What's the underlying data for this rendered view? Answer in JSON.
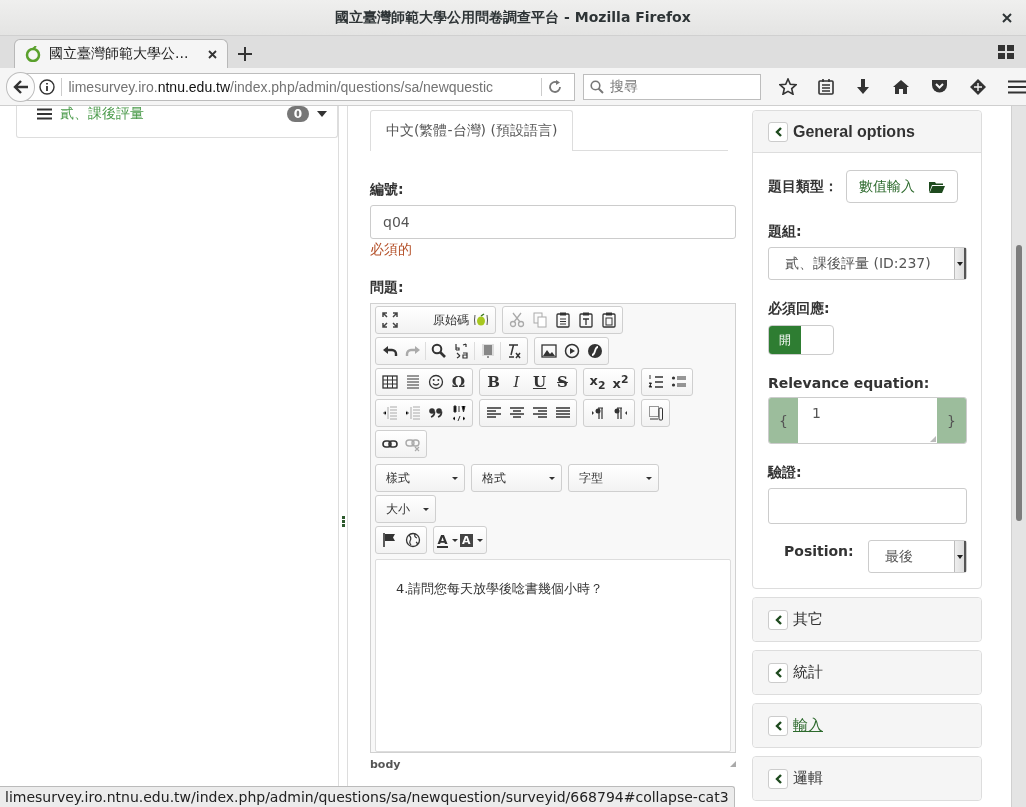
{
  "window": {
    "title": "國立臺灣師範大學公用問卷調查平台 - Mozilla Firefox"
  },
  "browser_tabs": [
    {
      "title": "國立臺灣師範大學公...",
      "selected": true
    }
  ],
  "address_bar": {
    "url_prefix": "limesurvey.iro.",
    "url_domain": "ntnu.edu.tw",
    "url_path": "/index.php/admin/questions/sa/newquestic"
  },
  "search_field": {
    "placeholder": "搜尋"
  },
  "sidebar": {
    "items": [
      {
        "label": "貳、課後評量",
        "count": "0"
      }
    ]
  },
  "language_tabs": [
    {
      "label": "中文(繁體-台灣) (預設語言)",
      "selected": true
    }
  ],
  "code_field": {
    "label": "編號:",
    "value": "q04",
    "note": "必須的"
  },
  "question_editor": {
    "label": "問題:",
    "toolbar": {
      "source": "原始碼",
      "special_character": "Ω",
      "bold": "B",
      "italic": "I",
      "underline": "U",
      "strike": "S",
      "subscript": "x$_{2}$",
      "superscript": "x$^{2}$",
      "text_color": "A",
      "background_color": "A",
      "dropdowns": [
        {
          "label": "樣式"
        },
        {
          "label": "格式"
        },
        {
          "label": "字型"
        },
        {
          "label": "大小"
        }
      ],
      "disabled": {
        "cut": true,
        "copy": true,
        "redo": true,
        "outdent": true,
        "indent": true,
        "unlink": true
      }
    },
    "content": "4.請問您每天放學後唸書幾個小時？",
    "path": "body"
  },
  "options_panels": [
    {
      "title": "General options",
      "expanded": true,
      "hovered": false
    },
    {
      "title": "其它",
      "expanded": false,
      "hovered": false
    },
    {
      "title": "統計",
      "expanded": false,
      "hovered": false
    },
    {
      "title": "輸入",
      "expanded": false,
      "hovered": true
    },
    {
      "title": "邏輯",
      "expanded": false,
      "hovered": false
    }
  ],
  "general_options": {
    "question_type": {
      "label": "題目類型：",
      "value": "數值輸入"
    },
    "group": {
      "label": "題組:",
      "value": "貳、課後評量 (ID:237)"
    },
    "mandatory": {
      "label": "必須回應:",
      "state_label": "開",
      "on": true
    },
    "relevance": {
      "label": "Relevance equation:",
      "open": "{",
      "value": "1",
      "close": "}"
    },
    "validation": {
      "label": "驗證:"
    },
    "position": {
      "label": "Position:",
      "value": "最後"
    }
  },
  "status_bar": {
    "url": "limesurvey.iro.ntnu.edu.tw/index.php/admin/questions/sa/newquestion/surveyid/668794#collapse-cat3"
  }
}
